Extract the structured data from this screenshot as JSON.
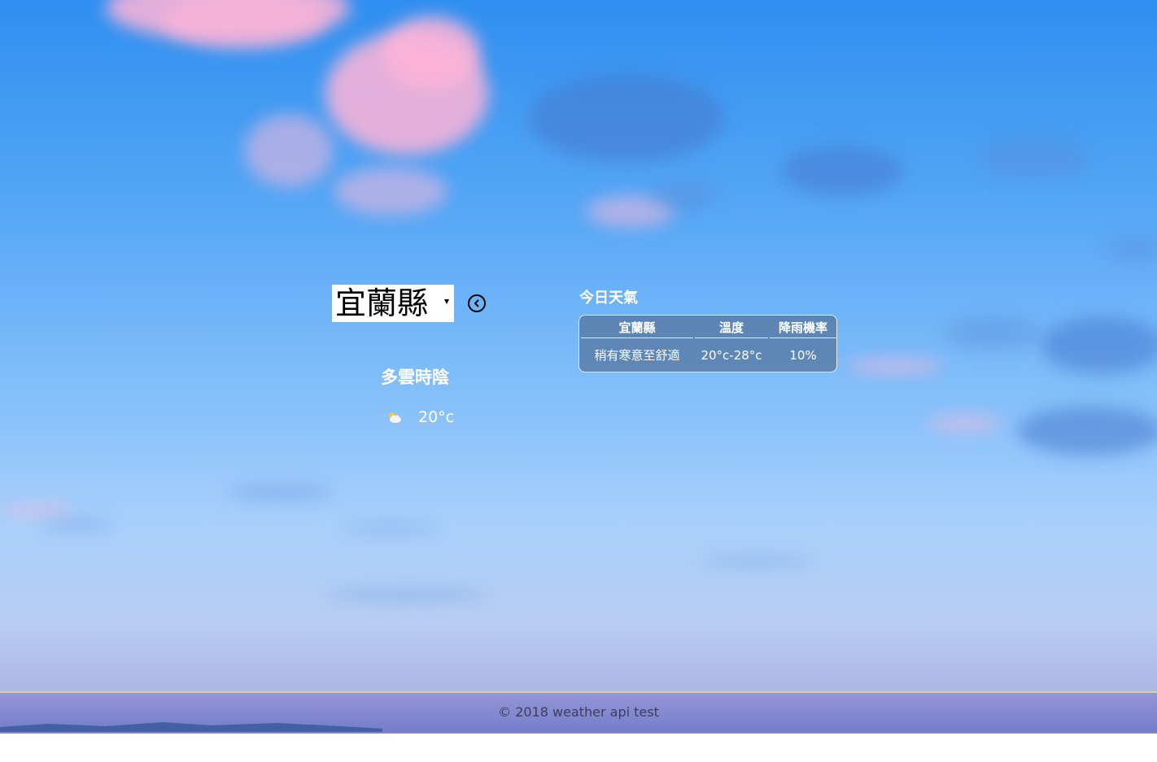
{
  "selector": {
    "selected_city": "宜蘭縣",
    "back_icon": "circle-chevron-left-icon"
  },
  "current": {
    "condition": "多雲時陰",
    "icon": "partly-cloudy-icon",
    "temperature": "20°c"
  },
  "today": {
    "title": "今日天氣",
    "headers": [
      "宜蘭縣",
      "溫度",
      "降雨機率"
    ],
    "row": [
      "稍有寒意至舒適",
      "20°c-28°c",
      "10%"
    ]
  },
  "footer": {
    "text": "© 2018 weather api test"
  },
  "colors": {
    "sky_top": "#2f8ff0",
    "sky_bottom": "#a6a8de",
    "table_bg": "#55739b",
    "footer_border": "#d8d49c"
  }
}
